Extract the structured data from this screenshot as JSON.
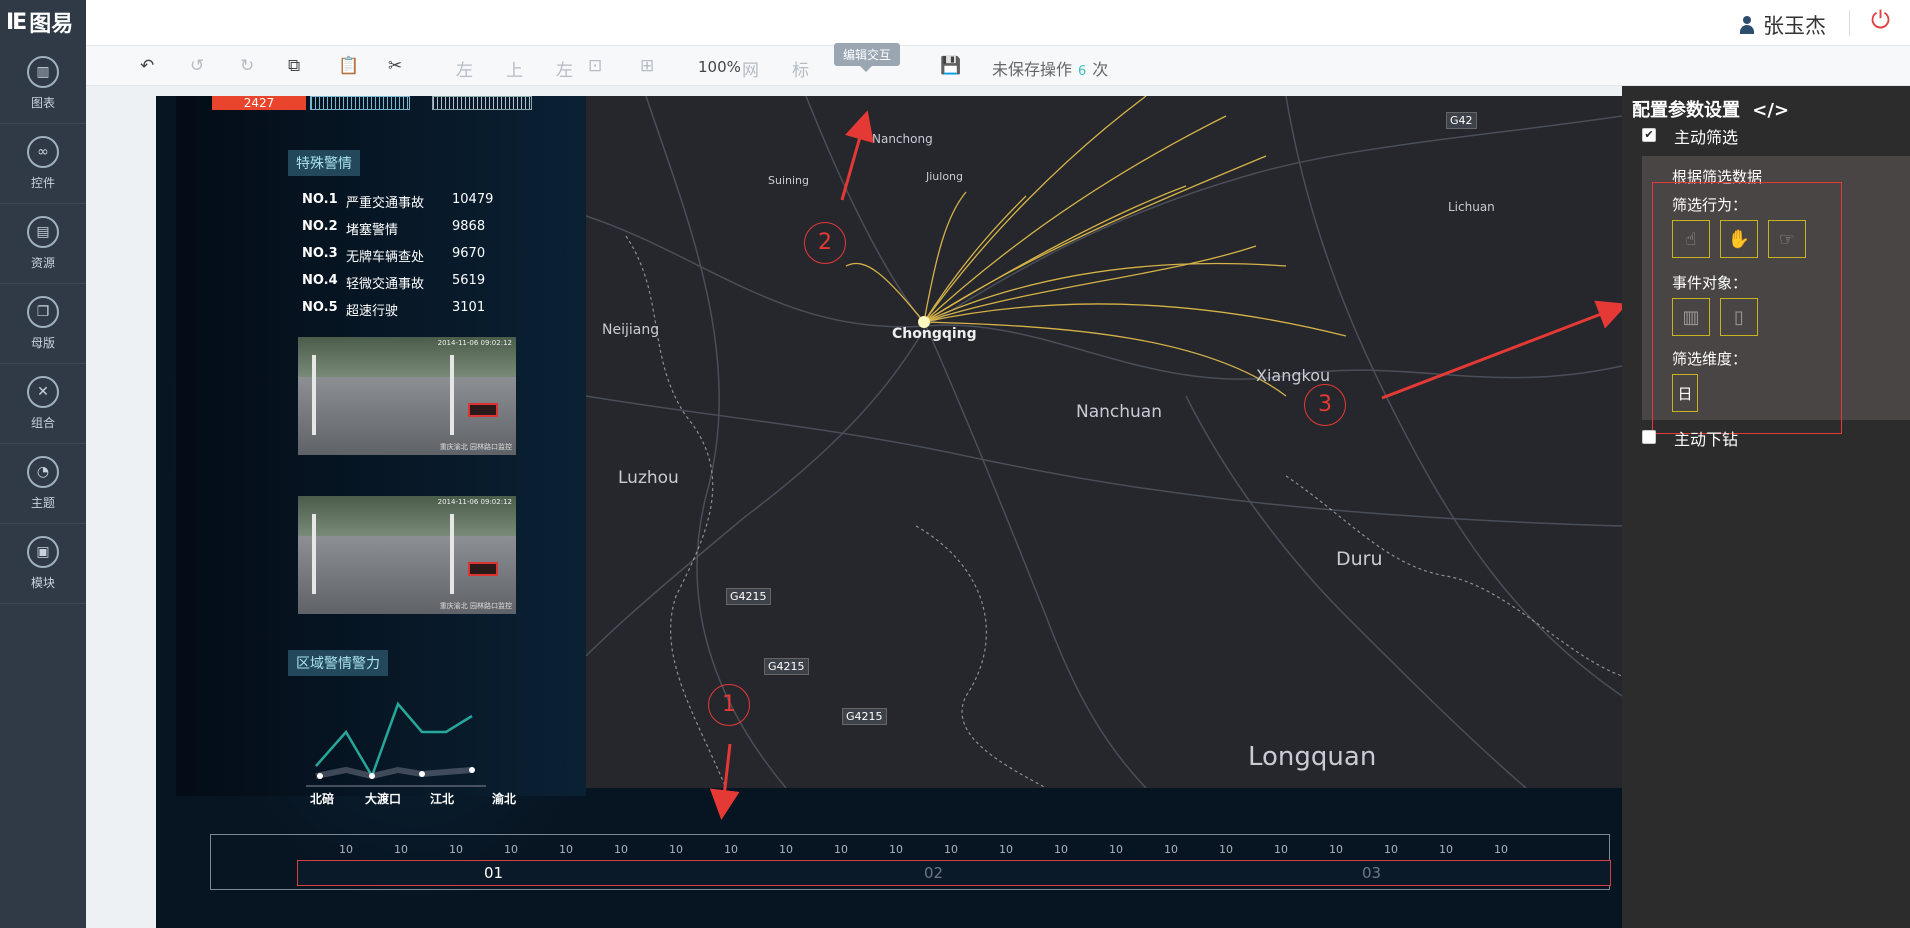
{
  "app": {
    "logo_mark": "IE",
    "logo_text": "图易"
  },
  "sidebar": {
    "items": [
      {
        "label": "图表",
        "icon": "bar-chart-icon"
      },
      {
        "label": "控件",
        "icon": "link-icon"
      },
      {
        "label": "资源",
        "icon": "book-icon"
      },
      {
        "label": "母版",
        "icon": "copy-icon"
      },
      {
        "label": "组合",
        "icon": "combine-icon"
      },
      {
        "label": "主题",
        "icon": "pie-icon"
      },
      {
        "label": "模块",
        "icon": "module-icon"
      }
    ]
  },
  "header": {
    "user_name": "张玉杰"
  },
  "toolbar": {
    "zoom": "100%",
    "grid_label": "网",
    "mark_label": "标",
    "align_left": "左",
    "align_top": "上",
    "align_left2": "左",
    "tooltip": "编辑交互",
    "unsaved_prefix": "未保存操作",
    "unsaved_count": "6",
    "unsaved_suffix": "次"
  },
  "dashboard": {
    "top_value": "2427",
    "special_title": "特殊警情",
    "ranking": [
      {
        "no": "NO.1",
        "name": "严重交通事故",
        "value": "10479"
      },
      {
        "no": "NO.2",
        "name": "堵塞警情",
        "value": "9868"
      },
      {
        "no": "NO.3",
        "name": "无牌车辆查处",
        "value": "9670"
      },
      {
        "no": "NO.4",
        "name": "轻微交通事故",
        "value": "5619"
      },
      {
        "no": "NO.5",
        "name": "超速行驶",
        "value": "3101"
      }
    ],
    "camera_timestamp": "2014-11-06 09:02:12",
    "camera_watermark": "重庆渝北\n园林路口监控",
    "region_title": "区域警情警力",
    "region_chart": {
      "categories": [
        "北碚",
        "大渡口",
        "江北",
        "渝北"
      ]
    },
    "map_labels": {
      "nanchong": "Nanchong",
      "suining": "Suining",
      "jiulong": "Jiulong",
      "chongqing": "Chongqing",
      "neijiang": "Neijiang",
      "nanchuan": "Nanchuan",
      "xiangkou": "Xiangkou",
      "luzhou": "Luzhou",
      "duru": "Duru",
      "longquan": "Longquan",
      "lichuan": "Lichuan",
      "g42": "G42",
      "g4215_a": "G4215",
      "g4215_b": "G4215",
      "g4215_c": "G4215"
    },
    "timeline": {
      "tick_label": "10",
      "segments": [
        "01",
        "02",
        "03"
      ]
    },
    "annotations": [
      "1",
      "2",
      "3"
    ]
  },
  "panel": {
    "title": "配置参数设置",
    "code_icon": "</>",
    "active_filter": "主动筛选",
    "filter_by_data": "根据筛选数据",
    "filter_action": "筛选行为：",
    "event_object": "事件对象：",
    "filter_dim": "筛选维度：",
    "dim_value": "日",
    "active_drill": "主动下钻"
  }
}
